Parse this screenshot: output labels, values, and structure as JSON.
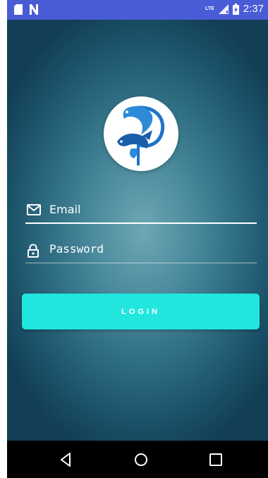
{
  "status_bar": {
    "network_label": "LTE",
    "time": "2:37",
    "icons": [
      "sd-card-icon",
      "n-notification-icon",
      "signal-icon",
      "battery-icon"
    ]
  },
  "login": {
    "email_placeholder": "Email",
    "password_placeholder": "Password",
    "button_label": "LOGIN"
  },
  "colors": {
    "status_bar": "#4a5bd6",
    "button": "#22e6de",
    "background_center": "#6fa6b3",
    "background_edge": "#123f56",
    "logo_blue": "#1f73c9"
  },
  "nav_bar": {
    "icons": [
      "back-icon",
      "home-icon",
      "recents-icon"
    ]
  }
}
